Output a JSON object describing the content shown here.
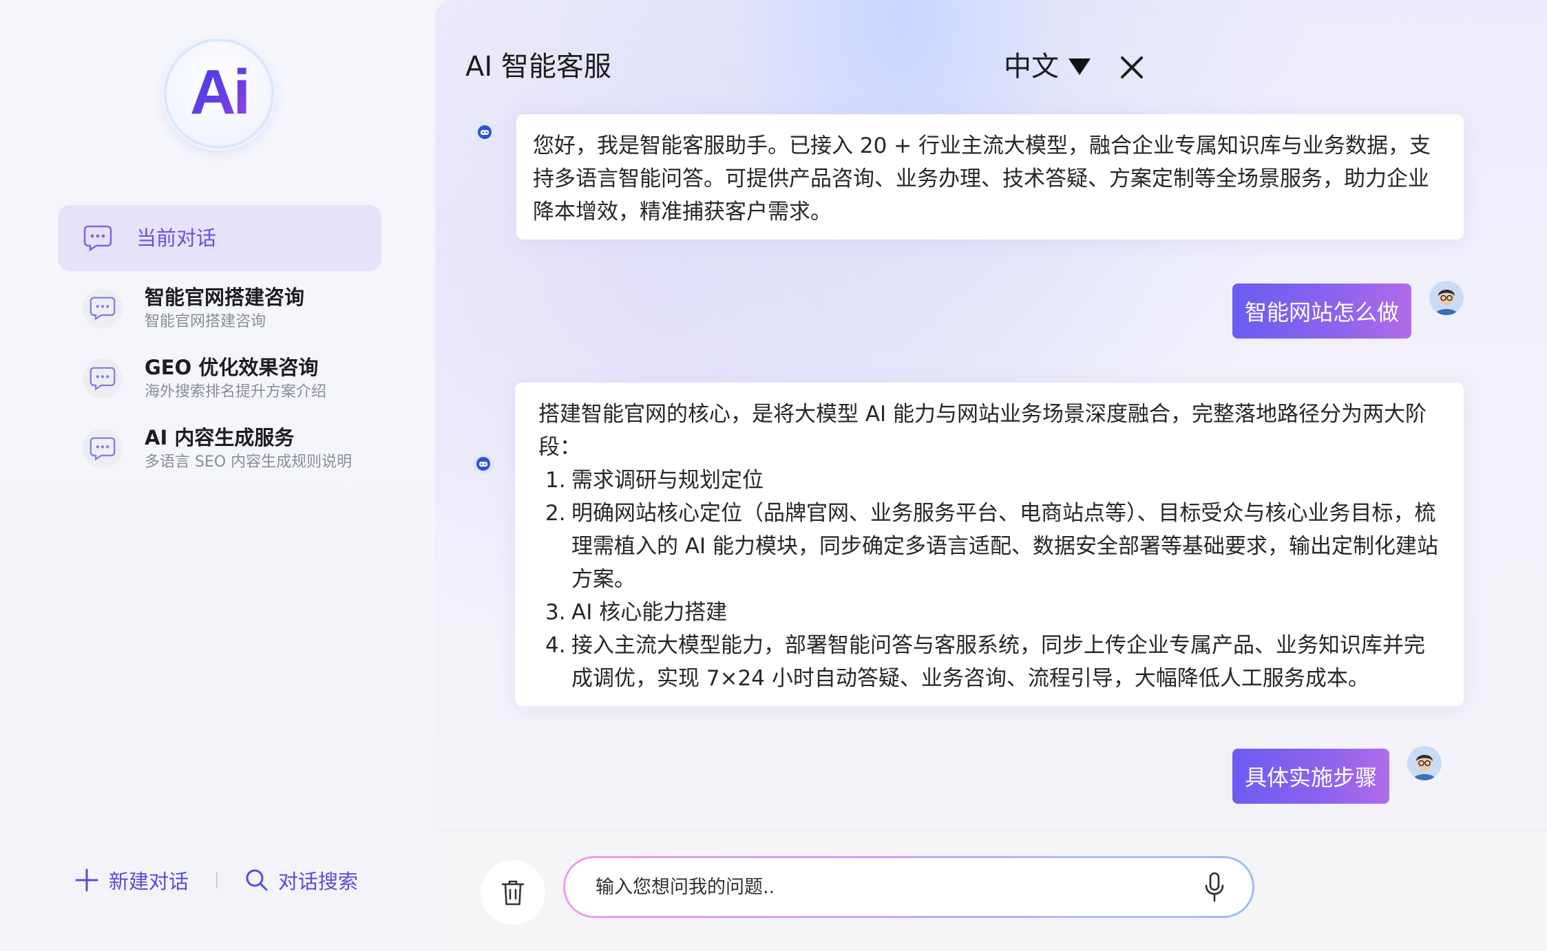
{
  "logo": {
    "text": "Ai"
  },
  "sidebar": {
    "conversations": [
      {
        "title": "当前对话",
        "subtitle": "",
        "active": true
      },
      {
        "title": "智能官网搭建咨询",
        "subtitle": "智能官网搭建咨询",
        "active": false
      },
      {
        "title": "GEO 优化效果咨询",
        "subtitle": "海外搜索排名提升方案介绍",
        "active": false
      },
      {
        "title": "AI 内容生成服务",
        "subtitle": "多语言 SEO 内容生成规则说明",
        "active": false
      }
    ],
    "new_chat_label": "新建对话",
    "search_label": "对话搜索"
  },
  "header": {
    "title": "AI 智能客服",
    "language": "中文"
  },
  "messages": {
    "bot_1": "您好，我是智能客服助手。已接入 20 + 行业主流大模型，融合企业专属知识库与业务数据，支持多语言智能问答。可提供产品咨询、业务办理、技术答疑、方案定制等全场景服务，助力企业降本增效，精准捕获客户需求。",
    "user_1": "智能网站怎么做",
    "bot_2": {
      "intro": "搭建智能官网的核心，是将大模型 AI 能力与网站业务场景深度融合，完整落地路径分为两大阶段：",
      "items": [
        {
          "num": "1.",
          "text": "需求调研与规划定位"
        },
        {
          "num": "2.",
          "text": "明确网站核心定位（品牌官网、业务服务平台、电商站点等）、目标受众与核心业务目标，梳理需植入的 AI 能力模块，同步确定多语言适配、数据安全部署等基础要求，输出定制化建站方案。"
        },
        {
          "num": "3.",
          "text": "AI 核心能力搭建"
        },
        {
          "num": "4.",
          "text": "接入主流大模型能力，部署智能问答与客服系统，同步上传企业专属产品、业务知识库并完成调优，实现 7×24 小时自动答疑、业务咨询、流程引导，大幅降低人工服务成本。"
        }
      ]
    },
    "user_2": "具体实施步骤"
  },
  "input": {
    "placeholder": "输入您想问我的问题..",
    "value": ""
  },
  "colors": {
    "accent": "#6b4ee0",
    "active_item_bg": "#e6e2fa",
    "user_bubble_start": "#6b5cf1",
    "user_bubble_end": "#b06ce8"
  }
}
